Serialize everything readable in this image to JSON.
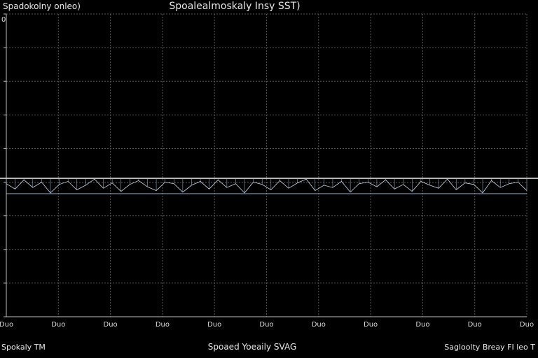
{
  "chart_data": {
    "type": "line",
    "top_left_label": "Spadokolny onleo)",
    "title": "Spoalealmoskaly Insy SST)",
    "bottom_left_label": "Spokaly TM",
    "xlabel": "Spoaed Yoeaily SVAG",
    "bottom_right_label": "Sagloolty Breay FI leo T",
    "x_tick_labels": [
      "Duo",
      "Duo",
      "Duo",
      "Duo",
      "Duo",
      "Duo",
      "Duo",
      "Duo",
      "Duo",
      "Duo",
      "Duo"
    ],
    "y_tick_labels": [
      "0"
    ],
    "grid": true,
    "series": [
      {
        "values": [
          0.3,
          -0.4,
          0.8,
          -0.2,
          0.5,
          -0.9,
          0.2,
          0.6,
          -0.5,
          0.1,
          0.9,
          -0.3,
          0.4,
          -0.7,
          0.2,
          0.7,
          -0.1,
          -0.6,
          0.5,
          0.3,
          -0.8,
          0.1,
          0.6,
          -0.4,
          0.8,
          -0.2,
          0.3,
          -0.9,
          0.5,
          0.2,
          -0.5,
          0.7,
          -0.3,
          0.4,
          0.9,
          -0.6,
          0.1,
          -0.2,
          0.6,
          -0.8,
          0.3,
          0.5,
          -0.1,
          0.8,
          -0.4,
          0.2,
          -0.7,
          0.6,
          0.1,
          -0.3,
          0.9,
          -0.5,
          0.4,
          0.2,
          -0.9,
          0.7,
          -0.2,
          0.3,
          0.5,
          -0.6
        ]
      }
    ]
  }
}
